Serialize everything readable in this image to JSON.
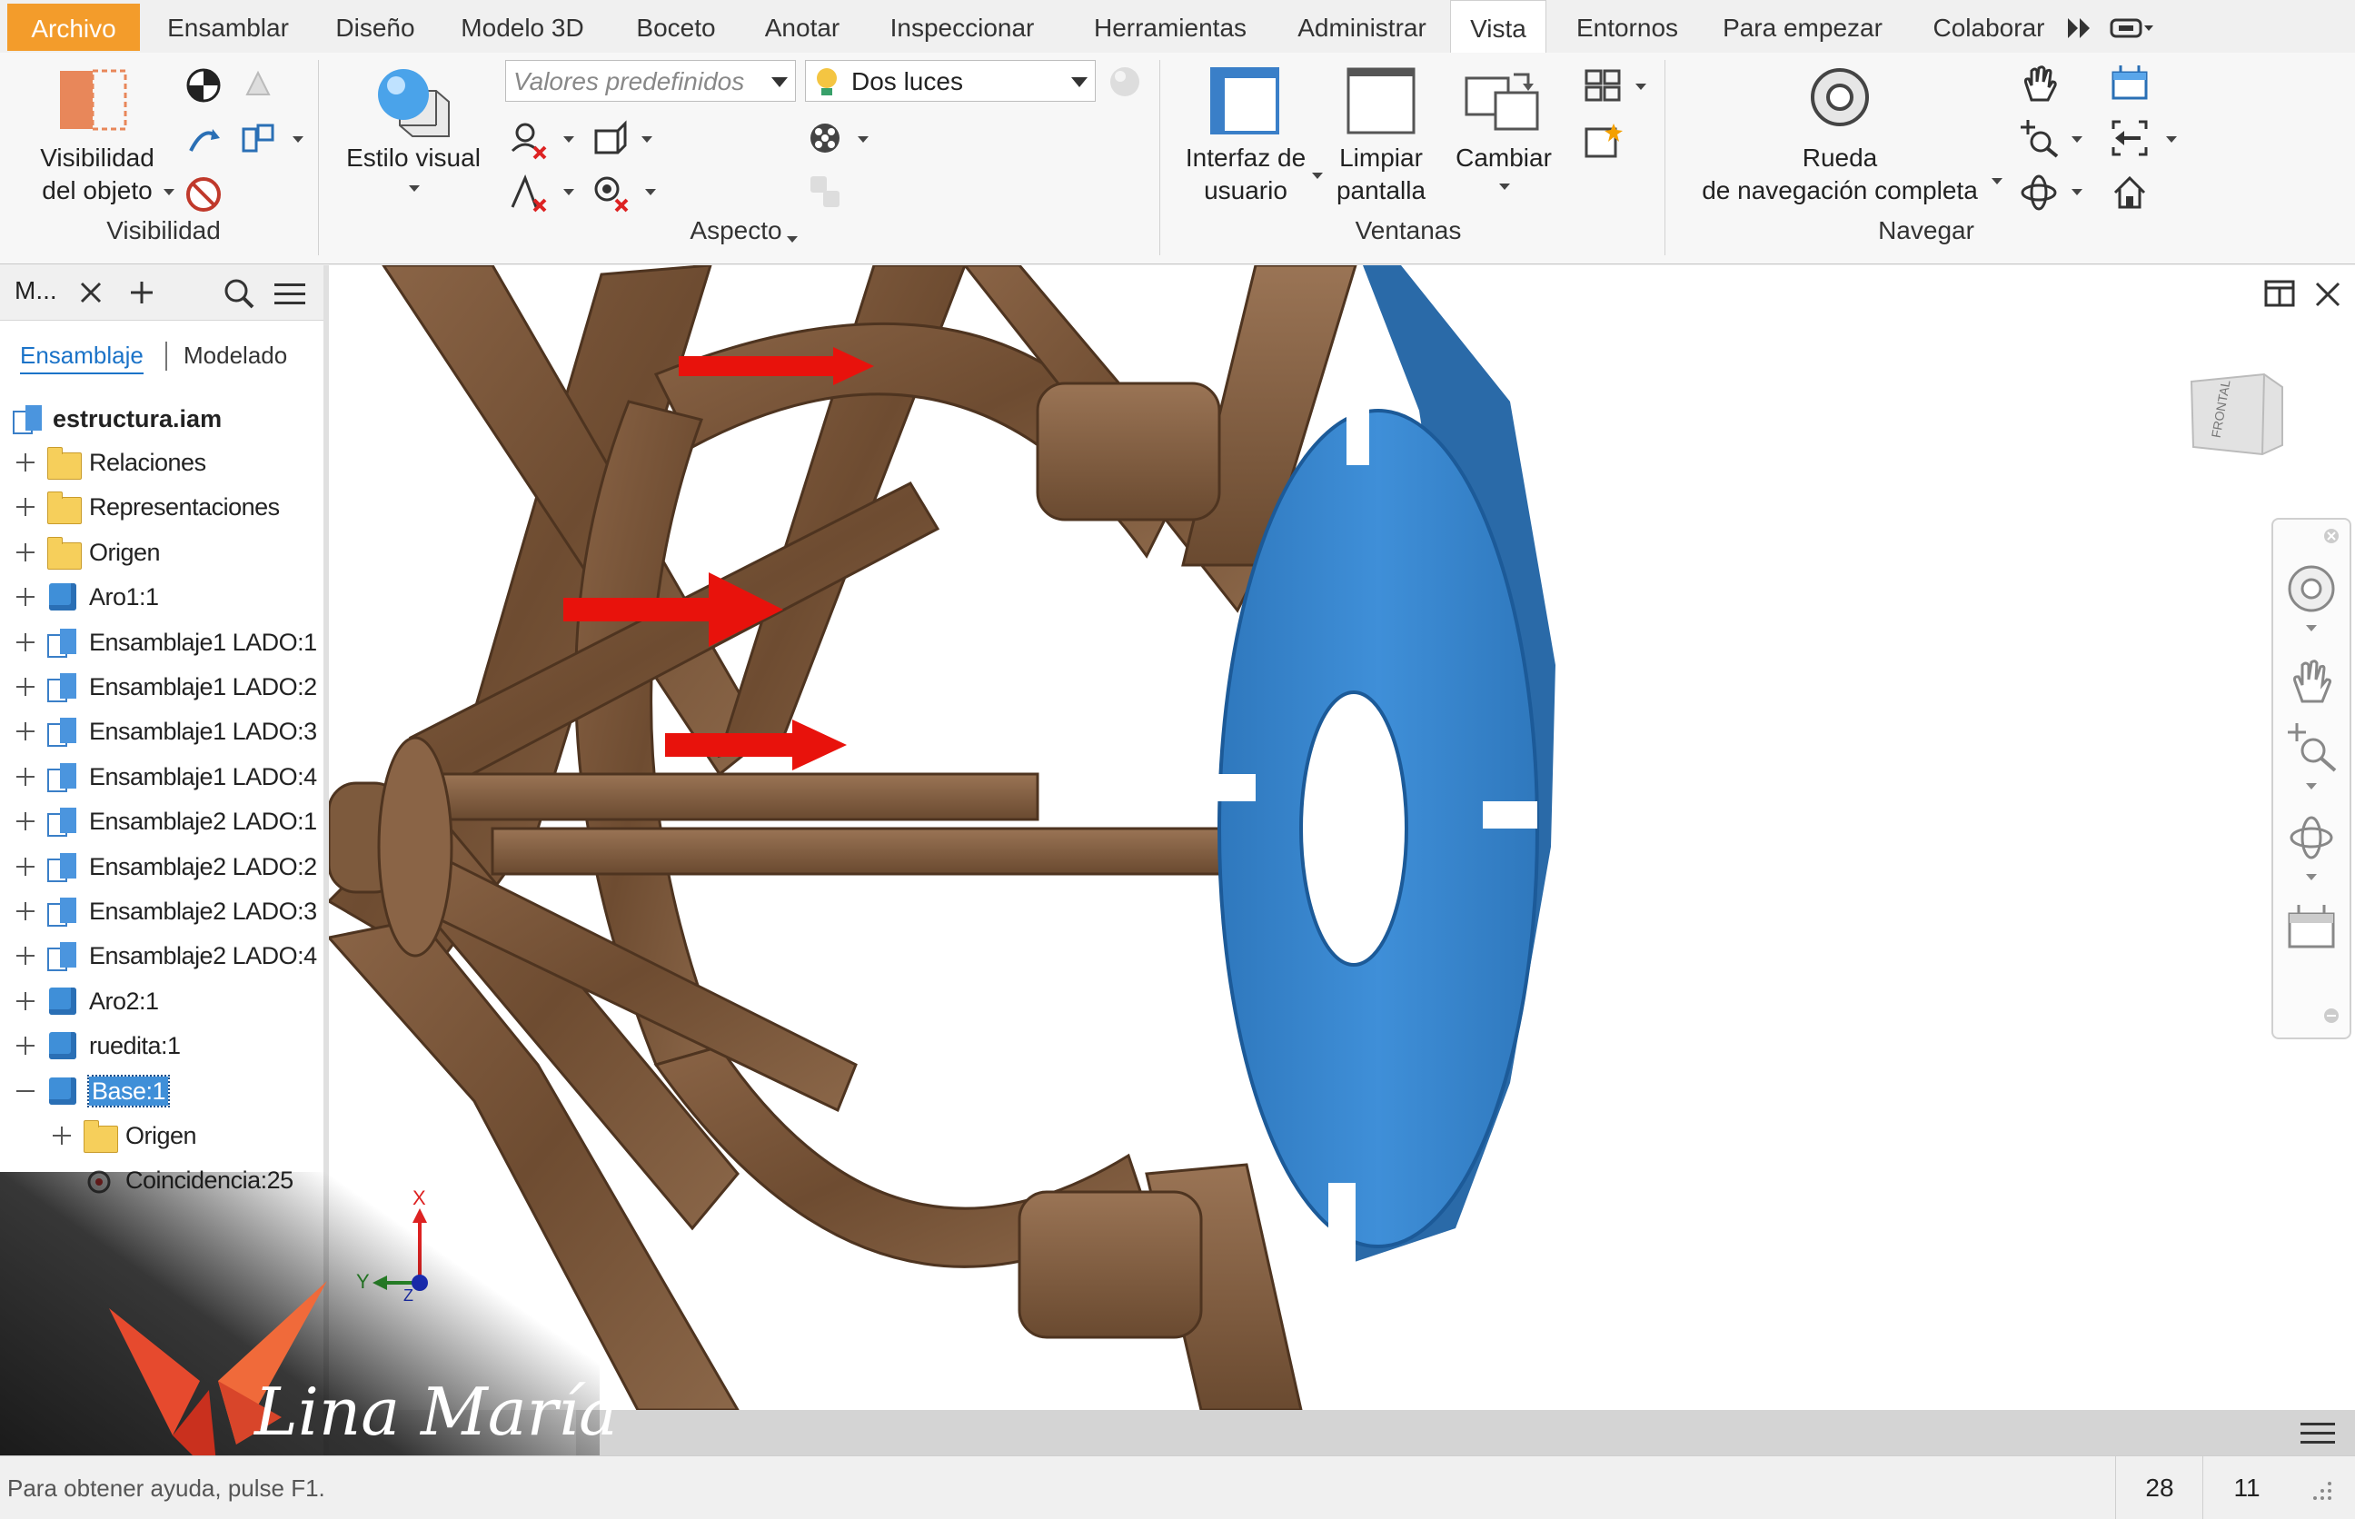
{
  "tabs": [
    "Archivo",
    "Ensamblar",
    "Diseño",
    "Modelo 3D",
    "Boceto",
    "Anotar",
    "Inspeccionar",
    "Herramientas",
    "Administrar",
    "Vista",
    "Entornos",
    "Para empezar",
    "Colaborar"
  ],
  "active_tab": "Vista",
  "ribbon": {
    "visibility": {
      "object_label_1": "Visibilidad",
      "object_label_2": "del objeto",
      "panel": "Visibilidad"
    },
    "appearance": {
      "visual_style_label": "Estilo visual",
      "presets_placeholder": "Valores predefinidos",
      "lighting_value": "Dos luces",
      "panel": "Aspecto"
    },
    "windows": {
      "ui_label_1": "Interfaz de",
      "ui_label_2": "usuario",
      "clear_label_1": "Limpiar",
      "clear_label_2": "pantalla",
      "switch_label": "Cambiar",
      "panel": "Ventanas"
    },
    "navigate": {
      "wheel_label_1": "Rueda",
      "wheel_label_2": "de navegación completa",
      "panel": "Navegar"
    }
  },
  "browser": {
    "title": "M...",
    "tab_assembly": "Ensamblaje",
    "tab_modeling": "Modelado",
    "root": "estructura.iam",
    "items": [
      {
        "label": "Relaciones",
        "icon": "relations-folder-icon",
        "level": 1,
        "expand": "+"
      },
      {
        "label": "Representaciones",
        "icon": "representations-folder-icon",
        "level": 1,
        "expand": "+"
      },
      {
        "label": "Origen",
        "icon": "origin-folder-icon",
        "level": 1,
        "expand": "+"
      },
      {
        "label": "Aro1:1",
        "icon": "part-icon",
        "level": 1,
        "expand": "+"
      },
      {
        "label": "Ensamblaje1 LADO:1",
        "icon": "subassembly-icon",
        "level": 1,
        "expand": "+"
      },
      {
        "label": "Ensamblaje1 LADO:2",
        "icon": "subassembly-icon",
        "level": 1,
        "expand": "+"
      },
      {
        "label": "Ensamblaje1 LADO:3",
        "icon": "subassembly-icon",
        "level": 1,
        "expand": "+"
      },
      {
        "label": "Ensamblaje1 LADO:4",
        "icon": "subassembly-icon",
        "level": 1,
        "expand": "+"
      },
      {
        "label": "Ensamblaje2 LADO:1",
        "icon": "subassembly-icon",
        "level": 1,
        "expand": "+"
      },
      {
        "label": "Ensamblaje2 LADO:2",
        "icon": "subassembly-icon",
        "level": 1,
        "expand": "+"
      },
      {
        "label": "Ensamblaje2 LADO:3",
        "icon": "subassembly-icon",
        "level": 1,
        "expand": "+"
      },
      {
        "label": "Ensamblaje2 LADO:4",
        "icon": "subassembly-icon",
        "level": 1,
        "expand": "+"
      },
      {
        "label": "Aro2:1",
        "icon": "part-icon",
        "level": 1,
        "expand": "+"
      },
      {
        "label": "ruedita:1",
        "icon": "part-icon",
        "level": 1,
        "expand": "+"
      },
      {
        "label": "Base:1",
        "icon": "part-icon",
        "level": 1,
        "expand": "-",
        "selected": true
      },
      {
        "label": "Origen",
        "icon": "origin-folder-icon",
        "level": 2,
        "expand": "+"
      },
      {
        "label": "Coincidencia:25",
        "icon": "constraint-icon",
        "level": 2,
        "expand": ""
      }
    ]
  },
  "viewcube_label": "FRONTAL",
  "axes": {
    "x": "X",
    "y": "Y",
    "z": "Z"
  },
  "watermark": "Lina María",
  "status": {
    "help": "Para obtener ayuda, pulse F1.",
    "count1": "28",
    "count2": "11"
  },
  "colors": {
    "accent": "#f39c2b",
    "selection": "#3f8fd8",
    "arrow": "#e8120c",
    "wood": "#7a5638"
  }
}
